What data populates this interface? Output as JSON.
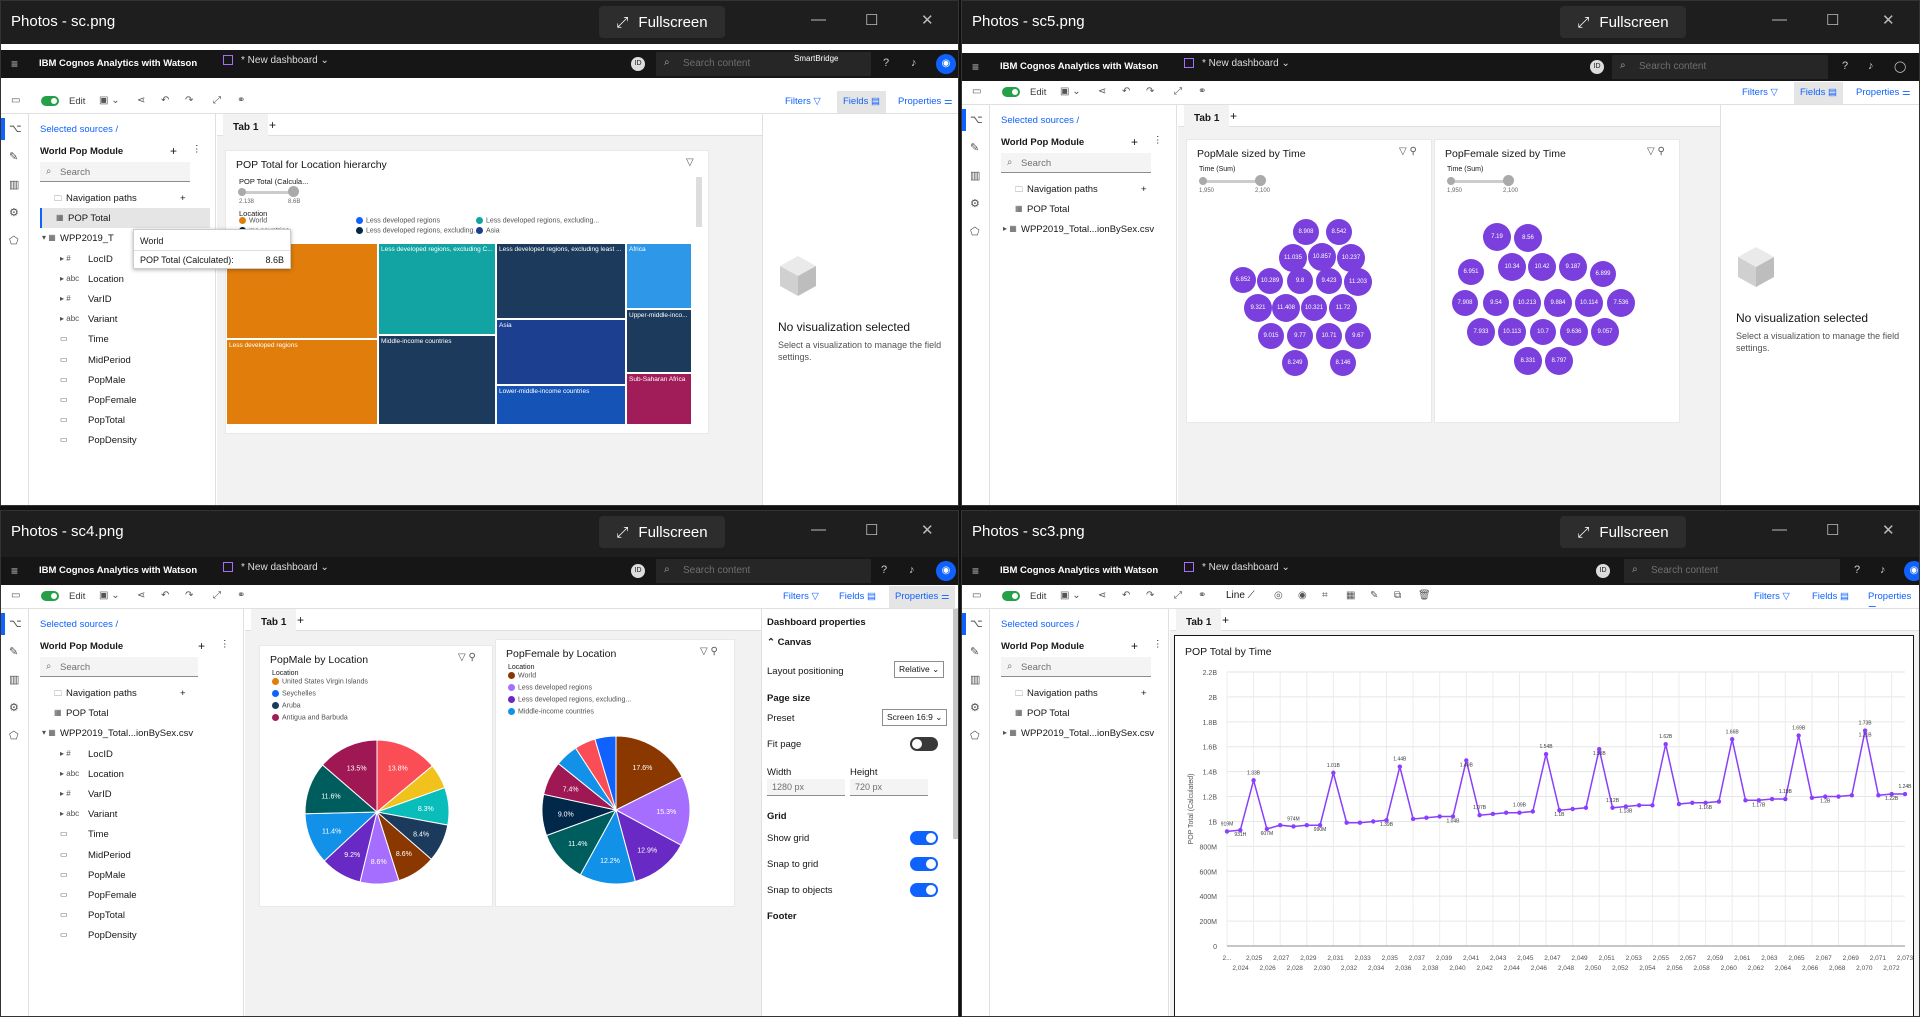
{
  "colors": {
    "accent": "#0f62fe",
    "purple": "#8a3ffc",
    "green": "#24a148"
  },
  "common": {
    "brand": "IBM Cognos Analytics with Watson",
    "dashboard": "* New dashboard",
    "search_placeholder": "Search content",
    "user_badge": "ID",
    "edit": "Edit",
    "filters": "Filters",
    "fields": "Fields",
    "properties": "Properties",
    "selected_sources": "Selected sources",
    "module": "World Pop Module",
    "search": "Search",
    "tab": "Tab 1",
    "fullscreen": "Fullscreen",
    "no_vis_title": "No visualization selected",
    "no_vis_sub": "Select a visualization to manage the field settings."
  },
  "w1": {
    "title": "Photos - sc.png",
    "tooltip_top": "SmartBridge",
    "tree": [
      "Navigation paths",
      "POP Total",
      "WPP2019_T",
      "LocID",
      "Location",
      "VarID",
      "Variant",
      "Time",
      "MidPeriod",
      "PopMale",
      "PopFemale",
      "PopTotal",
      "PopDensity"
    ],
    "hover": {
      "label": "World",
      "field": "POP Total (Calculated):",
      "value": "8.6B"
    },
    "chart": {
      "title": "POP Total for Location hierarchy",
      "slider_label": "POP Total (Calcula...",
      "slider_min": "2.138",
      "slider_max": "8.6B",
      "legend_title": "Location",
      "legend": [
        "World",
        "Less developed regions",
        "Less developed regions, excluding...",
        "me countries",
        "Less developed regions, excluding...",
        "Asia"
      ],
      "cells": [
        "Less developed regions",
        "Less developed regions, excluding C...",
        "Less developed regions, excluding least ...",
        "Africa",
        "Middle-income countries",
        "Asia",
        "Upper-middle-inco...",
        "Lower-middle-income countries",
        "Sub-Saharan Africa"
      ]
    }
  },
  "w2": {
    "title": "Photos - sc5.png",
    "tree": [
      "Navigation paths",
      "POP Total",
      "WPP2019_Total...ionBySex.csv"
    ],
    "male": {
      "title": "PopMale sized by Time",
      "slider_label": "Time (Sum)",
      "smin": "1,950",
      "smax": "2,100",
      "bubbles": [
        "8.908",
        "8.542",
        "11.035",
        "10.857",
        "10.237",
        "6.852",
        "10.289",
        "9.8",
        "9.423",
        "11.203",
        "9.321",
        "11.408",
        "10.321",
        "11.72",
        "9.015",
        "9.77",
        "10.71",
        "9.67",
        "8.249",
        "8.146"
      ]
    },
    "female": {
      "title": "PopFemale sized by Time",
      "slider_label": "Time (Sum)",
      "smin": "1,950",
      "smax": "2,100",
      "bubbles": [
        "7.19",
        "8.56",
        "10.34",
        "10.42",
        "9.187",
        "6.951",
        "6.899",
        "7.908",
        "9.54",
        "10.213",
        "9.884",
        "10.114",
        "7.536",
        "7.933",
        "10.113",
        "10.7",
        "9.636",
        "9.057",
        "8.331",
        "8.797"
      ]
    }
  },
  "w3": {
    "title": "Photos - sc4.png",
    "tree": [
      "Navigation paths",
      "POP Total",
      "WPP2019_Total...ionBySex.csv",
      "LocID",
      "Location",
      "VarID",
      "Variant",
      "Time",
      "MidPeriod",
      "PopMale",
      "PopFemale",
      "PopTotal",
      "PopDensity"
    ],
    "male": {
      "title": "PopMale by Location",
      "legend_title": "Location",
      "legend": [
        "United States Virgin Islands",
        "Seychelles",
        "Aruba",
        "Antigua and Barbuda"
      ],
      "slices": [
        {
          "label": "13.8%",
          "value": 13.8,
          "color": "#fa4d56"
        },
        {
          "label": "",
          "value": 5.5,
          "color": "#f1c21b"
        },
        {
          "label": "8.3%",
          "value": 8.3,
          "color": "#08bdba"
        },
        {
          "label": "8.4%",
          "value": 8.4,
          "color": "#1b3a5c"
        },
        {
          "label": "8.6%",
          "value": 8.6,
          "color": "#8a3800"
        },
        {
          "label": "8.6%",
          "value": 8.6,
          "color": "#a56eff"
        },
        {
          "label": "9.2%",
          "value": 9.2,
          "color": "#6929c4"
        },
        {
          "label": "11.4%",
          "value": 11.4,
          "color": "#1192e8"
        },
        {
          "label": "11.6%",
          "value": 11.6,
          "color": "#005d5d"
        },
        {
          "label": "13.5%",
          "value": 13.5,
          "color": "#9f1853"
        }
      ]
    },
    "female": {
      "title": "PopFemale by Location",
      "legend_title": "Location",
      "legend": [
        "World",
        "Less developed regions",
        "Less developed regions, excluding...",
        "Middle-income countries"
      ],
      "slices": [
        {
          "label": "17.6%",
          "value": 17.6,
          "color": "#8a3800"
        },
        {
          "label": "15.3%",
          "value": 15.3,
          "color": "#a56eff"
        },
        {
          "label": "12.9%",
          "value": 12.9,
          "color": "#6929c4"
        },
        {
          "label": "12.2%",
          "value": 12.2,
          "color": "#1192e8"
        },
        {
          "label": "11.4%",
          "value": 11.4,
          "color": "#005d5d"
        },
        {
          "label": "9.0%",
          "value": 9.0,
          "color": "#012749"
        },
        {
          "label": "7.4%",
          "value": 7.4,
          "color": "#9f1853"
        },
        {
          "label": "",
          "value": 5.0,
          "color": "#1192e8"
        },
        {
          "label": "",
          "value": 4.6,
          "color": "#fa4d56"
        },
        {
          "label": "",
          "value": 4.6,
          "color": "#0f62fe"
        }
      ]
    },
    "panel": {
      "header": "Dashboard properties",
      "canvas": "Canvas",
      "layout": "Layout positioning",
      "layout_val": "Relative",
      "page_size": "Page size",
      "preset": "Preset",
      "preset_val": "Screen 16:9",
      "fit": "Fit page",
      "width": "Width",
      "height": "Height",
      "wval": "1280 px",
      "hval": "720 px",
      "grid": "Grid",
      "show_grid": "Show grid",
      "snap_grid": "Snap to grid",
      "snap_obj": "Snap to objects",
      "footer": "Footer"
    }
  },
  "w4": {
    "title": "Photos - sc3.png",
    "tree": [
      "Navigation paths",
      "POP Total",
      "WPP2019_Total...ionBySex.csv"
    ],
    "line_label": "Line",
    "chart_data": {
      "type": "line",
      "title": "POP Total by Time",
      "ylabel": "POP Total (Calculated)",
      "yticks": [
        "2.2B",
        "2B",
        "1.8B",
        "1.6B",
        "1.4B",
        "1.2B",
        "1B",
        "800M",
        "600M",
        "400M",
        "200M",
        "0"
      ],
      "xticks_top": [
        "2...",
        "2,025",
        "2,027",
        "2,029",
        "2,031",
        "2,033",
        "2,035",
        "2,037",
        "2,039",
        "2,041",
        "2,043",
        "2,045",
        "2,047",
        "2,049",
        "2,051",
        "2,053",
        "2,055",
        "2,057",
        "2,059",
        "2,061",
        "2,063",
        "2,065",
        "2,067",
        "2,069",
        "2,071",
        "2,073"
      ],
      "xticks_bot": [
        "2,024",
        "2,026",
        "2,028",
        "2,030",
        "2,032",
        "2,034",
        "2,036",
        "2,038",
        "2,040",
        "2,042",
        "2,044",
        "2,046",
        "2,048",
        "2,050",
        "2,052",
        "2,054",
        "2,056",
        "2,058",
        "2,060",
        "2,062",
        "2,064",
        "2,066",
        "2,068",
        "2,070",
        "2,072"
      ],
      "values": [
        0.92,
        0.93,
        1.33,
        0.94,
        0.97,
        0.96,
        0.97,
        0.97,
        1.39,
        0.99,
        0.99,
        1.0,
        1.01,
        1.44,
        1.02,
        1.03,
        1.04,
        1.04,
        1.49,
        1.05,
        1.06,
        1.07,
        1.07,
        1.08,
        1.54,
        1.09,
        1.1,
        1.11,
        1.58,
        1.11,
        1.12,
        1.13,
        1.13,
        1.62,
        1.14,
        1.15,
        1.15,
        1.16,
        1.66,
        1.17,
        1.17,
        1.18,
        1.18,
        1.69,
        1.19,
        1.2,
        1.2,
        1.21,
        1.73,
        1.21,
        1.22,
        1.22
      ],
      "labels": [
        "919M",
        "931H",
        "1.33B",
        "607M",
        "974M",
        "990M",
        "1.01B",
        "1.39B",
        "1.44B",
        "1.04B",
        "1.07B",
        "1.49B",
        "1.09B",
        "1.1B",
        "1.54B",
        "1.58B",
        "1.12B",
        "1.13B",
        "1.62B",
        "1.16B",
        "1.66B",
        "1.17B",
        "1.19B",
        "1.2B",
        "1.69B",
        "1.21B",
        "1.73B",
        "1.22B",
        "1.24B"
      ]
    }
  }
}
